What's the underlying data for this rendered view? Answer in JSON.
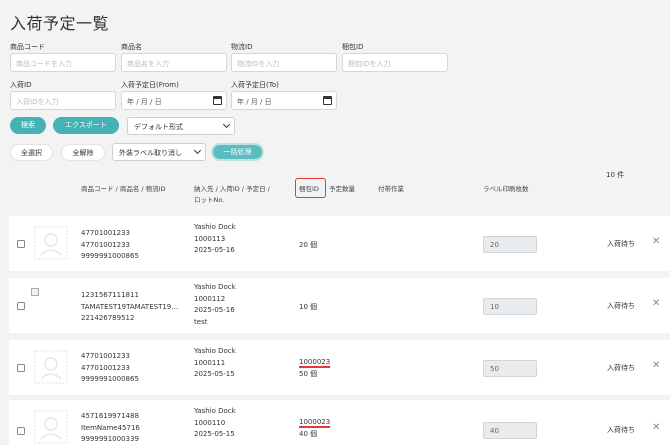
{
  "page_title": "入荷予定一覧",
  "filters": {
    "product_code": {
      "label": "商品コード",
      "placeholder": "商品コードを入力"
    },
    "product_name": {
      "label": "商品名",
      "placeholder": "商品名を入力"
    },
    "logistics_id": {
      "label": "物流ID",
      "placeholder": "物流IDを入力"
    },
    "package_id": {
      "label": "梱包ID",
      "placeholder": "梱包IDを入力"
    },
    "arrival_id": {
      "label": "入荷ID",
      "placeholder": "入荷IDを入力"
    },
    "date_from": {
      "label": "入荷予定日(From)",
      "value": "年 / 月 / 日"
    },
    "date_to": {
      "label": "入荷予定日(To)",
      "value": "年 / 月 / 日"
    }
  },
  "actions": {
    "search": "検索",
    "export": "エクスポート",
    "format_select": "デフォルト形式",
    "select_all": "全選択",
    "deselect_all": "全解除",
    "label_select": "外装ラベル取り消し",
    "bulk": "一括処理"
  },
  "count_label": "10 件",
  "headers": {
    "col1": "商品コード / 商品名 / 物流ID",
    "col2a": "納入先 / 入荷ID / 予定日 /",
    "col2b": "ロットNo.",
    "col3": "梱包ID",
    "col4": "予定数量",
    "col5": "付帯作業",
    "col6": "ラベル印刷枚数"
  },
  "rows": [
    {
      "code": "47701001233",
      "name": "47701001233",
      "logi": "9999991000865",
      "dest": "Yashio Dock",
      "arrival": "1000113",
      "date": "2025-05-16",
      "lot": "",
      "pkg": "",
      "qty": "20 個",
      "labels": "20",
      "status": "入荷待ち"
    },
    {
      "code": "1231567111811",
      "name": "TAMATEST19TAMATEST19…",
      "logi": "221426789512",
      "dest": "Yashio Dock",
      "arrival": "1000112",
      "date": "2025-05-16",
      "lot": "test",
      "pkg": "",
      "qty": "10 個",
      "labels": "10",
      "status": "入荷待ち"
    },
    {
      "code": "47701001233",
      "name": "47701001233",
      "logi": "9999991000865",
      "dest": "Yashio Dock",
      "arrival": "1000111",
      "date": "2025-05-15",
      "lot": "",
      "pkg": "1000023",
      "qty": "50 個",
      "labels": "50",
      "status": "入荷待ち"
    },
    {
      "code": "4571619971488",
      "name": "ItemName45716",
      "logi": "9999991000339",
      "dest": "Yashio Dock",
      "arrival": "1000110",
      "date": "2025-05-15",
      "lot": "",
      "pkg": "1000023",
      "qty": "40 個",
      "labels": "40",
      "status": "入荷待ち"
    }
  ],
  "icons": {
    "close": "close-icon",
    "calendar": "calendar-icon",
    "thumbnail": "product-thumbnail-icon"
  }
}
